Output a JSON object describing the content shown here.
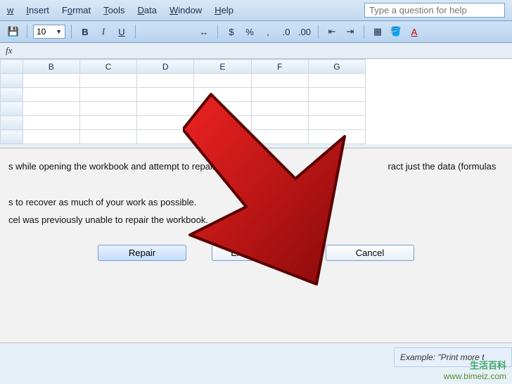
{
  "menubar": {
    "items": [
      {
        "pre": "",
        "u": "w",
        "post": ""
      },
      {
        "pre": "",
        "u": "I",
        "post": "nsert"
      },
      {
        "pre": "F",
        "u": "o",
        "post": "rmat"
      },
      {
        "pre": "",
        "u": "T",
        "post": "ools"
      },
      {
        "pre": "",
        "u": "D",
        "post": "ata"
      },
      {
        "pre": "",
        "u": "W",
        "post": "indow"
      },
      {
        "pre": "",
        "u": "H",
        "post": "elp"
      }
    ]
  },
  "help_placeholder": "Type a question for help",
  "toolbar": {
    "save_icon": "💾",
    "font_size": "10",
    "bold": "B",
    "italic": "I",
    "underline": "U",
    "merge": "↔",
    "currency": "$",
    "percent": "%",
    "comma": ",",
    "inc_dec": ".0",
    "dec_dec": ".00",
    "outdent": "⇤",
    "indent": "⇥",
    "borders": "▦",
    "fill": "🪣",
    "font_color": "A"
  },
  "formula_bar": {
    "fx": "fx"
  },
  "columns": [
    "B",
    "C",
    "D",
    "E",
    "F",
    "G"
  ],
  "dialog": {
    "line1_a": "s while opening the workbook and attempt to repair an",
    "line1_b": "ract just the data (formulas",
    "line2": "s to recover as much of your work as possible.",
    "line3": "cel was previously unable to repair the workbook.",
    "btn_repair": "Repair",
    "btn_extract": "Extract Data",
    "btn_cancel": "Cancel"
  },
  "bottom_snippet": "Example:  \"Print more t",
  "watermark": {
    "line1": "生活百科",
    "line2": "www.bimeiz.com"
  }
}
